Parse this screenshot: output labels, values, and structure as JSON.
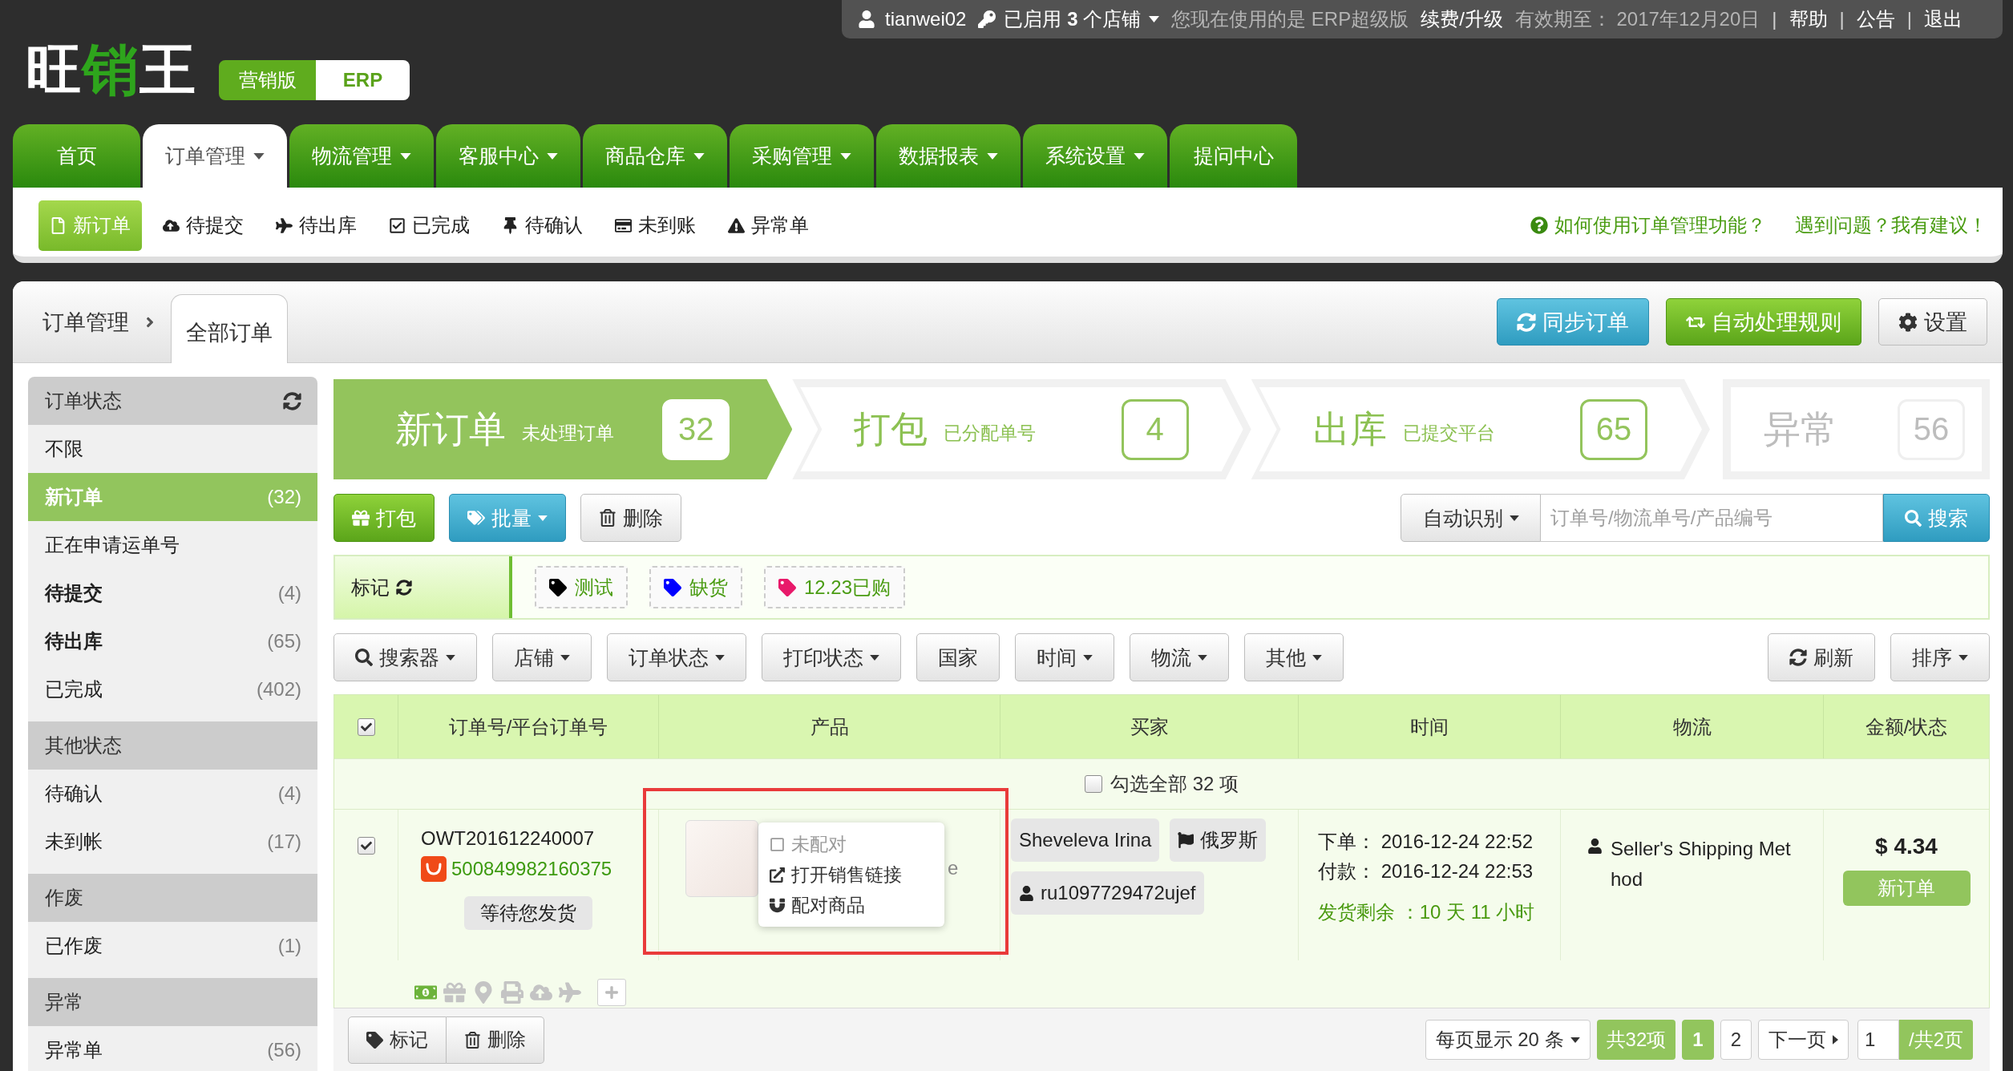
{
  "top_bar": {
    "items": [
      {
        "kind": "user",
        "text": "tianwei02"
      },
      {
        "kind": "stores",
        "text": "已启用 **3** 个店铺"
      },
      {
        "kind": "note",
        "text": "您现在使用的是 ERP超级版"
      },
      {
        "kind": "link",
        "text": "续费/升级"
      },
      {
        "kind": "note",
        "text": "有效期至： 2017年12月20日"
      },
      {
        "kind": "sep",
        "text": "|"
      },
      {
        "kind": "link",
        "text": "帮助"
      },
      {
        "kind": "sep",
        "text": "|"
      },
      {
        "kind": "link",
        "text": "公告"
      },
      {
        "kind": "sep",
        "text": "|"
      },
      {
        "kind": "link",
        "text": "退出"
      }
    ]
  },
  "logo": {
    "parts": [
      {
        "text": "旺",
        "accent": false
      },
      {
        "text": "销",
        "accent": true
      },
      {
        "text": "王",
        "accent": false
      }
    ]
  },
  "edition": [
    {
      "label": "营销版",
      "selected": false
    },
    {
      "label": "ERP",
      "selected": true
    }
  ],
  "nav": {
    "tabs": [
      {
        "label": "首页",
        "menu": false,
        "selected": false
      },
      {
        "label": "订单管理",
        "menu": true,
        "selected": true
      },
      {
        "label": "物流管理",
        "menu": true,
        "selected": false
      },
      {
        "label": "客服中心",
        "menu": true,
        "selected": false
      },
      {
        "label": "商品仓库",
        "menu": true,
        "selected": false
      },
      {
        "label": "采购管理",
        "menu": true,
        "selected": false
      },
      {
        "label": "数据报表",
        "menu": true,
        "selected": false
      },
      {
        "label": "系统设置",
        "menu": true,
        "selected": false
      },
      {
        "label": "提问中心",
        "menu": false,
        "selected": false
      }
    ]
  },
  "subnav": {
    "items": [
      {
        "label": "新订单",
        "selected": true
      },
      {
        "label": "待提交",
        "selected": false
      },
      {
        "label": "待出库",
        "selected": false
      },
      {
        "label": "已完成",
        "selected": false
      },
      {
        "label": "待确认",
        "selected": false
      },
      {
        "label": "未到账",
        "selected": false
      },
      {
        "label": "异常单",
        "selected": false
      }
    ],
    "help": [
      "如何使用订单管理功能？",
      "遇到问题？我有建议！"
    ]
  },
  "breadcrumb": {
    "parent": "订单管理",
    "current": "全部订单"
  },
  "header_actions": [
    {
      "kind": "primary",
      "label": "同步订单"
    },
    {
      "kind": "success",
      "label": "自动处理规则"
    },
    {
      "kind": "default",
      "label": "设置"
    }
  ],
  "sidebar": {
    "groups": [
      {
        "title": "订单状态",
        "refreshable": true,
        "items": [
          {
            "label": "不限",
            "selected": false,
            "emphasized": false
          },
          {
            "label": "新订单",
            "count": "(32)",
            "selected": true,
            "emphasized": false
          },
          {
            "label": "正在申请运单号",
            "selected": false,
            "emphasized": false
          },
          {
            "label": "待提交",
            "count": "(4)",
            "selected": false,
            "emphasized": true
          },
          {
            "label": "待出库",
            "count": "(65)",
            "selected": false,
            "emphasized": true
          },
          {
            "label": "已完成",
            "count": "(402)",
            "selected": false,
            "emphasized": false
          }
        ]
      },
      {
        "title": "其他状态",
        "refreshable": false,
        "items": [
          {
            "label": "待确认",
            "count": "(4)",
            "selected": false,
            "emphasized": false
          },
          {
            "label": "未到帐",
            "count": "(17)",
            "selected": false,
            "emphasized": false
          }
        ]
      },
      {
        "title": "作废",
        "refreshable": false,
        "items": [
          {
            "label": "已作废",
            "count": "(1)",
            "selected": false,
            "emphasized": false
          }
        ]
      },
      {
        "title": "异常",
        "refreshable": false,
        "items": [
          {
            "label": "异常单",
            "count": "(56)",
            "selected": false,
            "emphasized": false
          }
        ]
      }
    ]
  },
  "pipeline": {
    "steps": [
      {
        "kind": "stage",
        "title": "新订单",
        "subtitle": "未处理订单",
        "count": "32",
        "selected": true
      },
      {
        "kind": "stage",
        "title": "打包",
        "subtitle": "已分配单号",
        "count": "4",
        "selected": false
      },
      {
        "kind": "stage",
        "title": "出库",
        "subtitle": "已提交平台",
        "count": "65",
        "selected": false
      },
      {
        "kind": "alert",
        "title": "异常",
        "count": "56",
        "selected": false
      }
    ]
  },
  "actions": [
    {
      "kind": "success",
      "label": "打包",
      "menu": false
    },
    {
      "kind": "primary",
      "label": "批量",
      "menu": true
    },
    {
      "kind": "default",
      "label": "删除",
      "menu": false
    }
  ],
  "search": {
    "mode": "自动识别",
    "placeholder": "订单号/物流单号/产品编号",
    "button": "搜索"
  },
  "tags": {
    "label": "标记",
    "items": [
      {
        "label": "测试",
        "color": "#000000"
      },
      {
        "label": "缺货",
        "color": "#0000ff"
      },
      {
        "label": "12.23已购",
        "color": "#e8196a"
      }
    ]
  },
  "filters": {
    "left": [
      {
        "label": "搜索器",
        "menu": true
      },
      {
        "label": "店铺",
        "menu": true
      },
      {
        "label": "订单状态",
        "menu": true
      },
      {
        "label": "打印状态",
        "menu": true
      },
      {
        "label": "国家",
        "menu": false
      },
      {
        "label": "时间",
        "menu": true
      },
      {
        "label": "物流",
        "menu": true
      },
      {
        "label": "其他",
        "menu": true
      }
    ],
    "right": [
      {
        "label": "刷新",
        "menu": false
      },
      {
        "label": "排序",
        "menu": true
      }
    ]
  },
  "table": {
    "header_checked": true,
    "columns": [
      "订单号/平台订单号",
      "产品",
      "买家",
      "时间",
      "物流",
      "金额/状态"
    ],
    "select_all": {
      "label": "勾选全部 32 项",
      "checked": false
    },
    "rows": [
      {
        "checked": true,
        "order_no": "OWT201612240007",
        "platform_order_no": "500849982160375",
        "order_status": "等待您发货",
        "product": {
          "title_fragment": "e",
          "highlighted": true,
          "menu": [
            {
              "label": "未配对",
              "disabled": true
            },
            {
              "label": "打开销售链接",
              "disabled": false
            },
            {
              "label": "配对商品",
              "disabled": false
            }
          ]
        },
        "buyer": {
          "name": "Sheveleva Irina",
          "country": "俄罗斯",
          "account": "ru1097729472ujef"
        },
        "time": {
          "ordered": "下单： 2016-12-24 22:52",
          "paid": "付款： 2016-12-24 22:53",
          "remaining": "发货剩余 ：10 天 11 小时"
        },
        "logistics": "Seller's Shipping Method",
        "amount": "$ 4.34",
        "status": "新订单",
        "indicators": [
          {
            "on": true
          },
          {
            "on": false
          },
          {
            "on": false
          },
          {
            "on": false
          },
          {
            "on": false
          },
          {
            "on": false
          }
        ]
      }
    ]
  },
  "bottom": {
    "bulk": [
      "标记",
      "删除"
    ],
    "pagination": {
      "page_size": "每页显示 20 条",
      "total": "共32项",
      "pages": [
        {
          "label": "1",
          "selected": true
        },
        {
          "label": "2",
          "selected": false
        }
      ],
      "next": "下一页",
      "current_input": "1",
      "page_count": "/共2页"
    }
  }
}
